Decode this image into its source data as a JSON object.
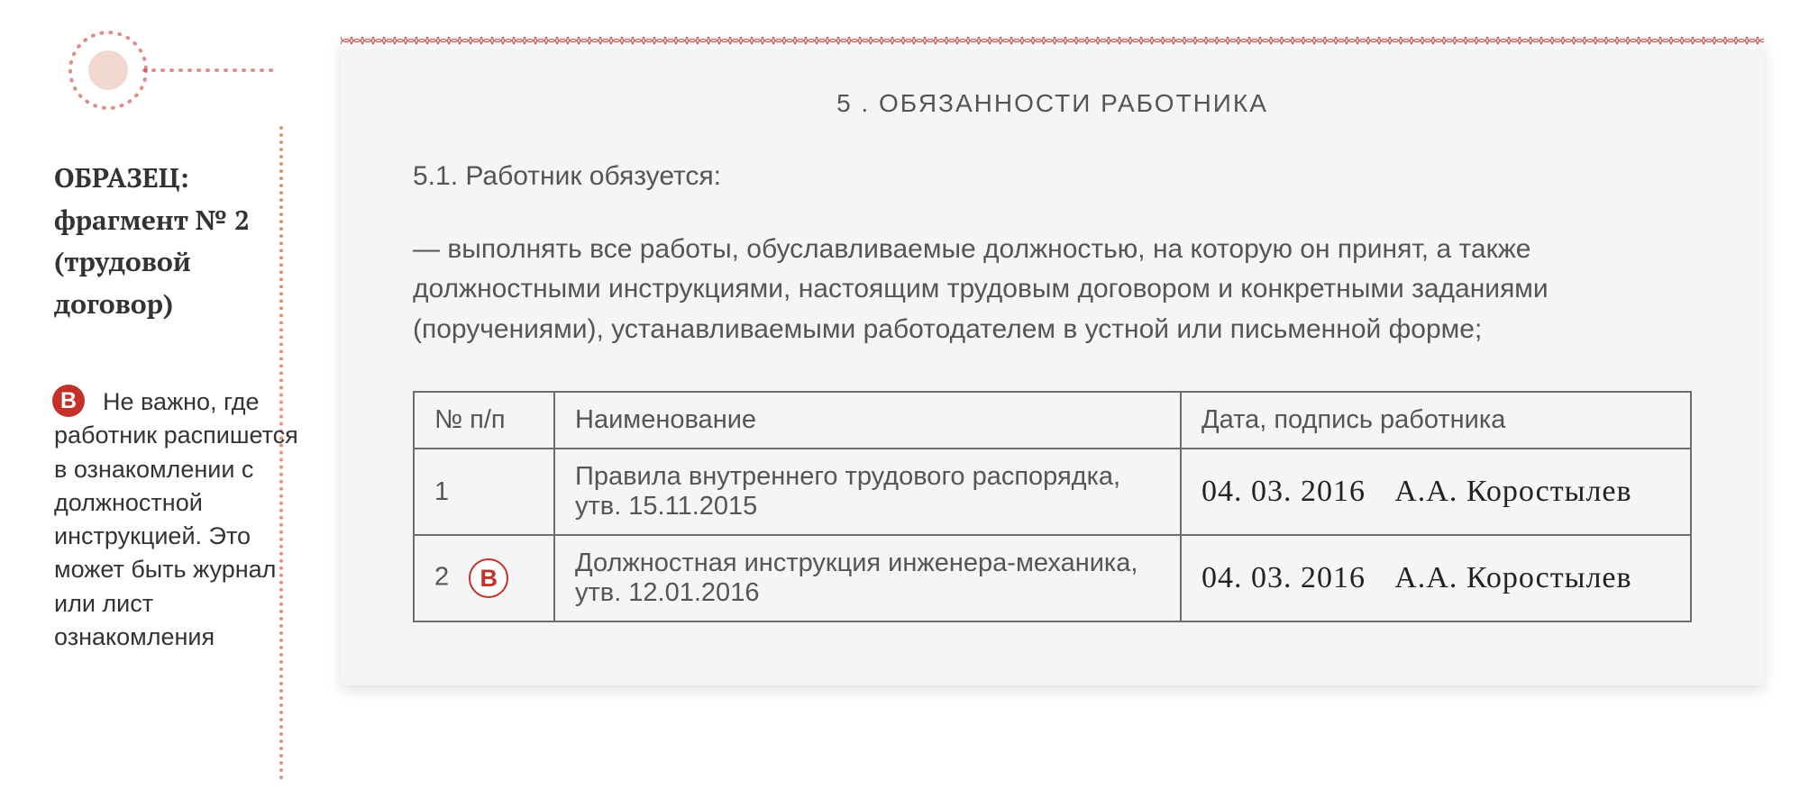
{
  "sidebar": {
    "title_line1": "ОБРАЗЕЦ:",
    "title_line2": "фрагмент № 2",
    "title_line3": "(трудовой договор)",
    "note_marker": "В",
    "note_text": "Не важно, где работ­ник распишется в ознакомлении с должностной инструкцией. Это может быть журнал или лист ознакомления"
  },
  "document": {
    "heading": "5 . ОБЯЗАННОСТИ РАБОТНИКА",
    "clause_lead": "5.1.  Работник обязуется:",
    "clause_body": "— выполнять все работы, обуславливаемые должностью, на которую он принят, а также должностными инструкциями, настоящим трудовым договором и конкретными заданиями (поручениями), устанавливаемыми работодателем в устной или письменной форме;",
    "table": {
      "headers": {
        "num": "№ п/п",
        "name": "Наименование",
        "sign": "Дата, подпись работника"
      },
      "rows": [
        {
          "num": "1",
          "name": "Правила внутреннего трудового рас­порядка, утв. 15.11.2015",
          "date": "04. 03. 2016",
          "signature": "А.А. Коростылев",
          "has_marker": false
        },
        {
          "num": "2",
          "name": "Должностная инструкция инженера-механика, утв. 12.01.2016",
          "date": "04. 03. 2016",
          "signature": "А.А. Коростылев",
          "has_marker": true,
          "marker": "В"
        }
      ]
    }
  }
}
